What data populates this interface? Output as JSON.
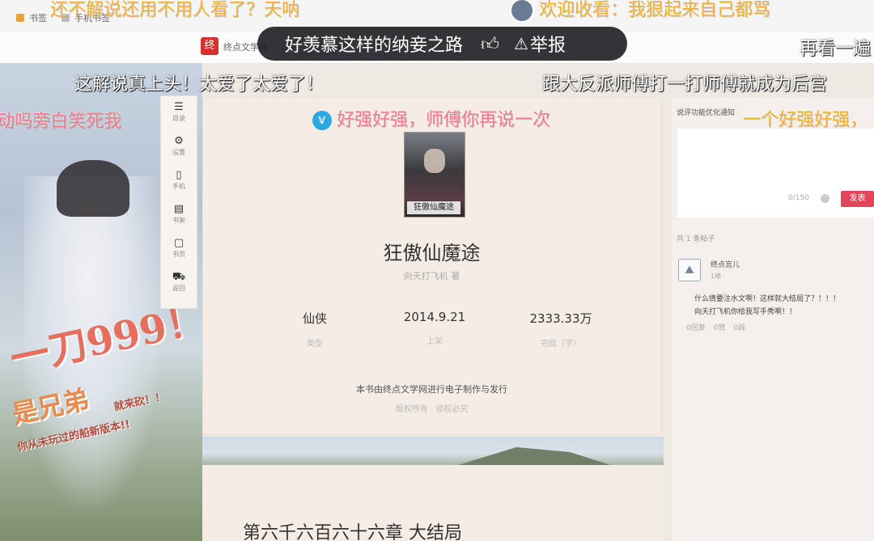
{
  "browser": {
    "bookmarks": [
      {
        "label": "书签"
      },
      {
        "label": "手机书签"
      }
    ]
  },
  "site": {
    "logo_char": "终",
    "name": "终点文学网"
  },
  "overlay": {
    "text": "好羡慕这样的纳妾之路",
    "like_icon": "thumbs-up-icon",
    "report_label": "举报",
    "report_icon": "warning-icon"
  },
  "danmaku": {
    "d1": "还不解说还用不用人看了？天呐",
    "d2": "欢迎收看：我狠起来自己都骂",
    "d3": "再看一遍",
    "d4": "这解说真上头！太爱了太爱了！",
    "d5": "跟大反派师傅打一打师傅就成为后宫",
    "d6": "动吗旁白笑死我",
    "d7": "好强好强，师傅你再说一次",
    "d8": "一个好强好强，"
  },
  "side_nav": [
    {
      "icon": "list-icon",
      "label": "目录"
    },
    {
      "icon": "gear-icon",
      "label": "设置"
    },
    {
      "icon": "phone-icon",
      "label": "手机"
    },
    {
      "icon": "book-icon",
      "label": "书架"
    },
    {
      "icon": "document-icon",
      "label": "书页"
    },
    {
      "icon": "car-icon",
      "label": "返回"
    }
  ],
  "book": {
    "cover_title": "狂傲仙魔途",
    "title": "狂傲仙魔途",
    "author": "向天打飞机 著",
    "stats": [
      {
        "value": "仙侠",
        "label": "类型"
      },
      {
        "value": "2014.9.21",
        "label": "上架"
      },
      {
        "value": "2333.33万",
        "label": "完结（字）"
      }
    ],
    "publisher_note": "本书由终点文学网进行电子制作与发行",
    "copyright": "版权所有 · 侵权必究"
  },
  "chapter": {
    "title": "第六千六百六十六章 大结局"
  },
  "comments": {
    "header": "说评功能优化通知",
    "char_count": "0/150",
    "send_label": "发表",
    "post_count": "共 1 条帖子",
    "post": {
      "user": "终点宫儿",
      "level": "1楼",
      "lines": [
        "什么情要注水文啊！这样就大结局了？！！！",
        "向天打飞机你给我写手秀啊！！"
      ],
      "actions": [
        "0回复",
        "0赞",
        "0踩"
      ]
    }
  }
}
